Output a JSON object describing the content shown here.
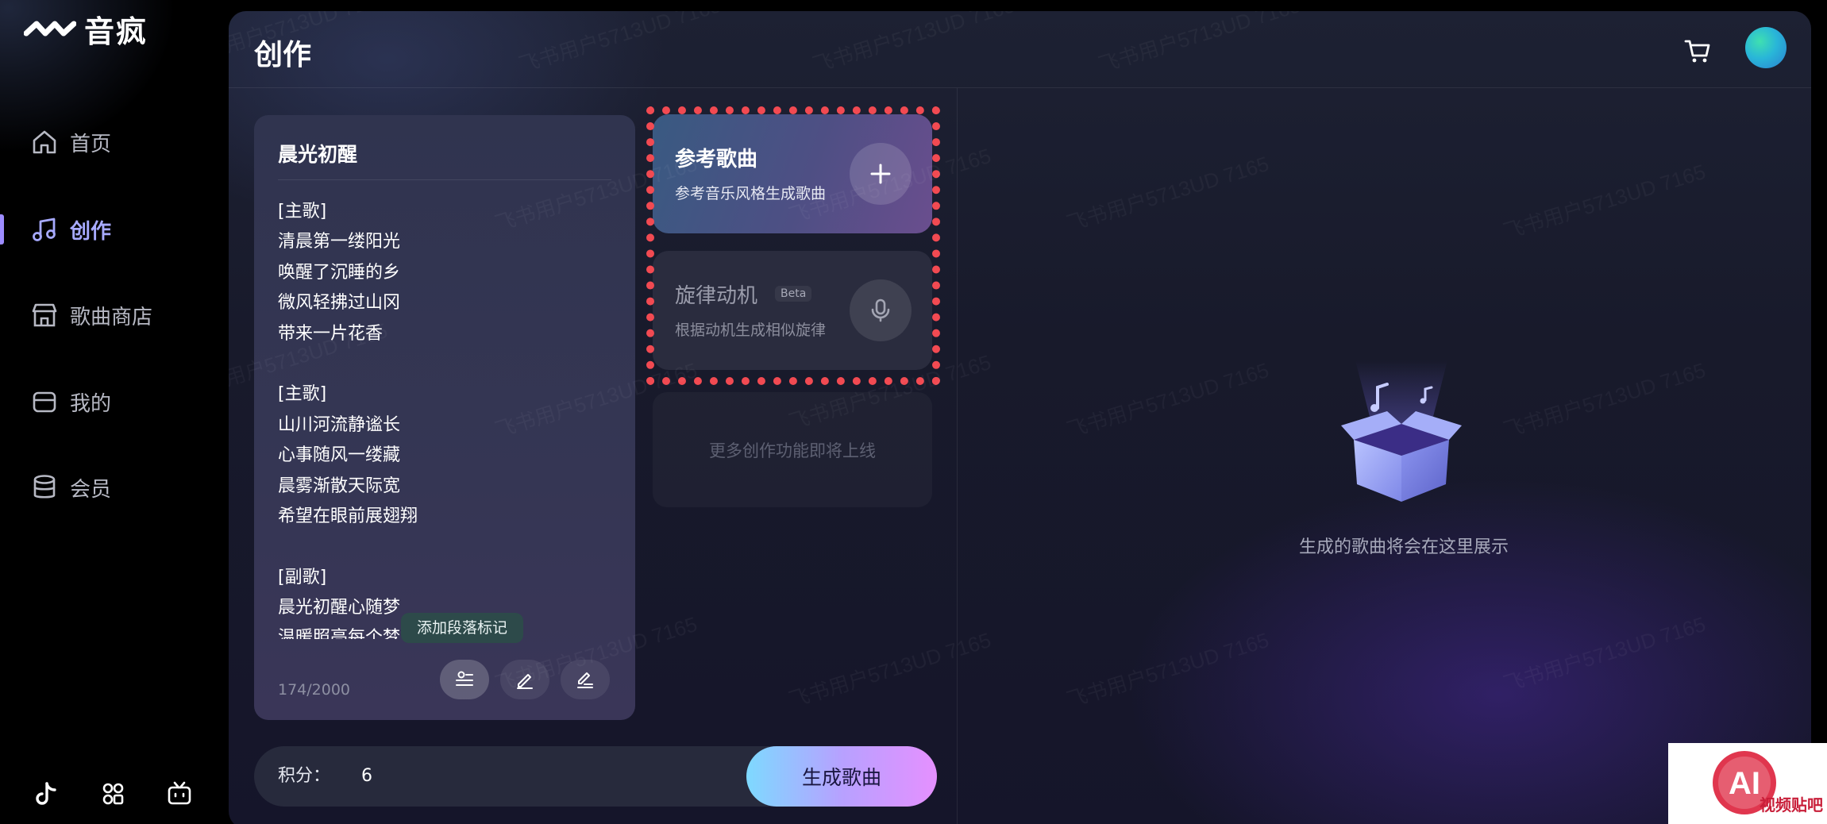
{
  "app": {
    "name": "音疯"
  },
  "sidebar": {
    "items": [
      {
        "label": "首页",
        "icon": "home-icon"
      },
      {
        "label": "创作",
        "icon": "music-note-icon",
        "active": true
      },
      {
        "label": "歌曲商店",
        "icon": "store-icon"
      },
      {
        "label": "我的",
        "icon": "wallet-icon"
      },
      {
        "label": "会员",
        "icon": "database-icon"
      }
    ],
    "bottom_icons": [
      "tiktok-icon",
      "community-icon",
      "tv-icon"
    ]
  },
  "header": {
    "title": "创作",
    "cart_icon": "cart-icon"
  },
  "lyrics": {
    "title": "晨光初醒",
    "lines": [
      "[主歌]",
      "清晨第一缕阳光",
      "唤醒了沉睡的乡",
      "微风轻拂过山冈",
      "带来一片花香",
      "",
      "[主歌]",
      "山川河流静谧长",
      "心事随风一缕藏",
      "晨雾渐散天际宽",
      "希望在眼前展翅翔",
      "",
      "[副歌]",
      "晨光初醒心随梦",
      "温暖照亮每个梦"
    ],
    "char_count": "174/2000",
    "tooltip": "添加段落标记"
  },
  "functions": {
    "reference": {
      "title": "参考歌曲",
      "subtitle": "参考音乐风格生成歌曲",
      "action_icon": "plus-icon"
    },
    "melody": {
      "title": "旋律动机",
      "badge": "Beta",
      "subtitle": "根据动机生成相似旋律",
      "action_icon": "microphone-icon"
    },
    "coming_soon": "更多创作功能即将上线"
  },
  "bottom_bar": {
    "points_label": "积分：",
    "points_value": "6",
    "generate_label": "生成歌曲"
  },
  "empty_state": {
    "text": "生成的歌曲将会在这里展示",
    "icon": "empty-box-icon"
  },
  "watermark": "飞书用户5713UD 7165",
  "corner_logo": {
    "text": "视频贴吧",
    "mark": "AI"
  },
  "colors": {
    "accent": "#a7aaff",
    "frame": "#f24a52",
    "generate_from": "#7ed9ff",
    "generate_to": "#e590ff"
  }
}
